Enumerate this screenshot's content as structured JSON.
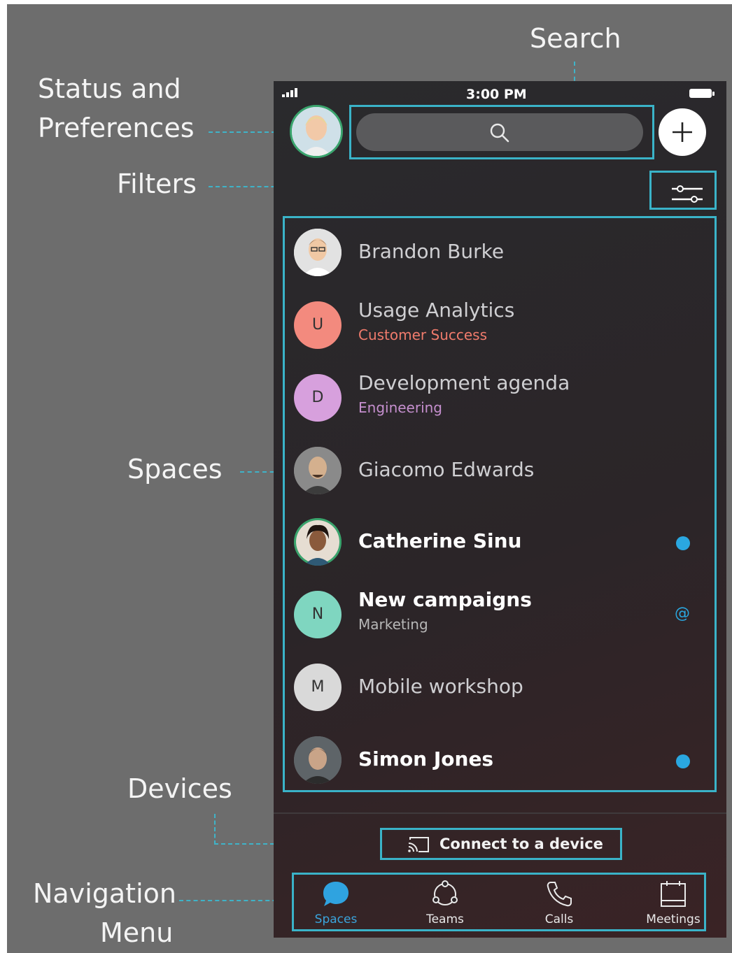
{
  "callouts": {
    "search": "Search",
    "status_line1": "Status and",
    "status_line2": "Preferences",
    "filters": "Filters",
    "spaces": "Spaces",
    "devices": "Devices",
    "nav_line1": "Navigation",
    "nav_line2": "Menu"
  },
  "status_bar": {
    "time": "3:00 PM"
  },
  "spaces": [
    {
      "name": "Brandon Burke",
      "subtitle": "",
      "avatar": "photo",
      "bold": false,
      "indicator": ""
    },
    {
      "name": "Usage Analytics",
      "subtitle": "Customer Success",
      "avatar_letter": "U",
      "avatar_color": "#f38a7e",
      "subtitle_color": "#f07b6c",
      "bold": false,
      "indicator": ""
    },
    {
      "name": "Development agenda",
      "subtitle": "Engineering",
      "avatar_letter": "D",
      "avatar_color": "#d7a0dd",
      "subtitle_color": "#c58fce",
      "bold": false,
      "indicator": ""
    },
    {
      "name": "Giacomo Edwards",
      "subtitle": "",
      "avatar": "photo",
      "bold": false,
      "indicator": ""
    },
    {
      "name": "Catherine Sinu",
      "subtitle": "",
      "avatar": "photo",
      "bold": true,
      "indicator": "unread-dot"
    },
    {
      "name": "New campaigns",
      "subtitle": "Marketing",
      "avatar_letter": "N",
      "avatar_color": "#7fd6c0",
      "subtitle_color": "#b7b7b7",
      "bold": true,
      "indicator": "@"
    },
    {
      "name": "Mobile workshop",
      "subtitle": "",
      "avatar_letter": "M",
      "avatar_color": "#d9d9d9",
      "bold": false,
      "indicator": ""
    },
    {
      "name": "Simon Jones",
      "subtitle": "",
      "avatar": "photo",
      "bold": true,
      "indicator": "unread-dot"
    }
  ],
  "device_button": {
    "label": "Connect to a device",
    "icon": "cast-icon"
  },
  "nav": [
    {
      "label": "Spaces",
      "icon": "chat-bubble-icon",
      "active": true
    },
    {
      "label": "Teams",
      "icon": "teams-icon",
      "active": false
    },
    {
      "label": "Calls",
      "icon": "phone-icon",
      "active": false
    },
    {
      "label": "Meetings",
      "icon": "calendar-icon",
      "active": false
    }
  ],
  "colors": {
    "accent": "#3ab3c8",
    "unread": "#2aa7e0",
    "presence": "#3aa46d"
  }
}
